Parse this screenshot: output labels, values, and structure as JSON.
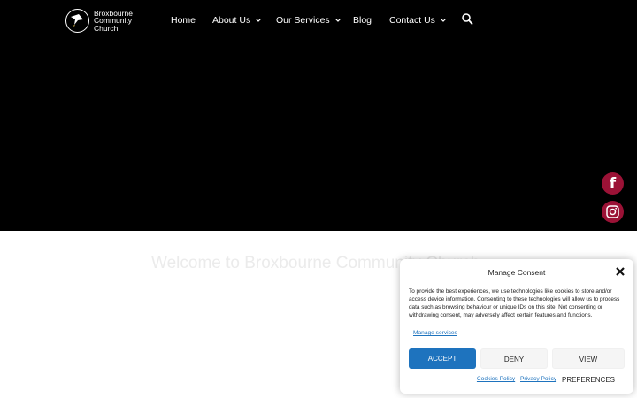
{
  "header": {
    "logo": {
      "line1": "Broxbourne",
      "line2": "Community",
      "line3": "Church"
    },
    "nav": [
      {
        "label": "Home",
        "has_dropdown": false
      },
      {
        "label": "About Us",
        "has_dropdown": true
      },
      {
        "label": "Our Services",
        "has_dropdown": true
      },
      {
        "label": "Blog",
        "has_dropdown": false
      },
      {
        "label": "Contact Us",
        "has_dropdown": true
      }
    ],
    "search_icon": "search-icon"
  },
  "hero": {
    "background": "#000000"
  },
  "social": [
    {
      "icon": "facebook-icon",
      "color": "#9b1236"
    },
    {
      "icon": "instagram-icon",
      "color": "#9b1236"
    }
  ],
  "main": {
    "welcome_heading": "Welcome to Broxbourne Community Church"
  },
  "consent": {
    "title": "Manage Consent",
    "close_icon": "close-icon",
    "body": "To provide the best experiences, we use technologies like cookies to store and/or access device information. Consenting to these technologies will allow us to process data such as browsing behaviour or unique IDs on this site. Not consenting or withdrawing consent, may adversely affect certain features and functions.",
    "manage_services": "Manage services",
    "buttons": {
      "accept": "ACCEPT",
      "deny": "DENY",
      "view_preferences": "VIEW PREFERENCES"
    },
    "links": {
      "cookies_policy": "Cookies Policy",
      "privacy_policy": "Privacy Policy"
    },
    "accent_color": "#1e73be"
  }
}
